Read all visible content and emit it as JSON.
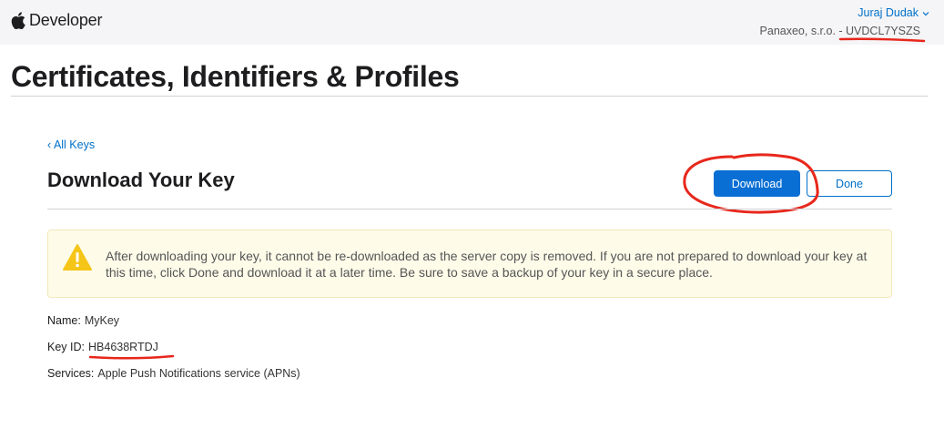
{
  "header": {
    "brand": "Developer",
    "user_name": "Juraj Dudak",
    "team_name": "Panaxeo, s.r.o. - UVDCL7YSZS"
  },
  "page": {
    "title": "Certificates, Identifiers & Profiles"
  },
  "section": {
    "back_link": "‹ All Keys",
    "title": "Download Your Key",
    "download_button": "Download",
    "done_button": "Done"
  },
  "alert": {
    "text": "After downloading your key, it cannot be re-downloaded as the server copy is removed. If you are not prepared to download your key at this time, click Done and download it at a later time. Be sure to save a backup of your key in a secure place."
  },
  "details": {
    "name_label": "Name:",
    "name_value": "MyKey",
    "key_id_label": "Key ID:",
    "key_id_value": "HB4638RTDJ",
    "services_label": "Services:",
    "services_value": "Apple Push Notifications service (APNs)"
  },
  "colors": {
    "accent": "#0070c9",
    "annotation": "#e8271c",
    "alert_background": "#fefbe9",
    "warning_icon": "#f5c518"
  },
  "icons": [
    "apple-logo-icon",
    "chevron-down-icon",
    "warning-icon"
  ]
}
